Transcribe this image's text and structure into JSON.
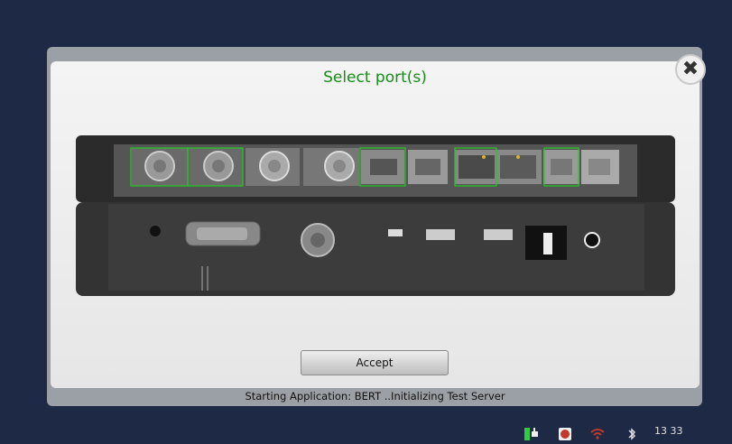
{
  "dialog": {
    "title": "Select port(s)",
    "accept_label": "Accept",
    "close_label": "✖"
  },
  "status": {
    "message": "Starting Application: BERT ..Initializing Test Server"
  },
  "taskbar": {
    "time": "13 33",
    "icons": [
      "power-plug-icon",
      "stop-icon",
      "wifi-icon",
      "bluetooth-icon"
    ]
  },
  "colors": {
    "title": "#1a8a1a",
    "port_highlight": "#22cc22",
    "background": "#1e2a45"
  }
}
